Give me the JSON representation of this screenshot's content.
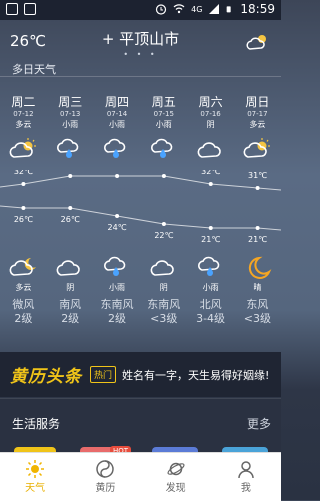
{
  "status_bar": {
    "network": "4G",
    "time": "18:59"
  },
  "header": {
    "current_temp": "26℃",
    "add_symbol": "+",
    "city": "平顶山市",
    "page_dots": "• • •"
  },
  "forecast_title": "多日天气",
  "days": [
    {
      "name": "周二",
      "date": "07-12",
      "day_cond": "多云",
      "day_icon": "partly-cloudy-sun-icon",
      "high": "32℃",
      "low": "26℃",
      "night_icon": "partly-cloudy-moon-icon",
      "night_cond": "多云",
      "wind": "微风",
      "level": "2级"
    },
    {
      "name": "周三",
      "date": "07-13",
      "day_cond": "小雨",
      "day_icon": "light-rain-icon",
      "high": "34℃",
      "low": "26℃",
      "night_icon": "cloudy-icon",
      "night_cond": "阴",
      "wind": "南风",
      "level": "2级"
    },
    {
      "name": "周四",
      "date": "07-14",
      "day_cond": "小雨",
      "day_icon": "light-rain-icon",
      "high": "34℃",
      "low": "24℃",
      "night_icon": "light-rain-icon",
      "night_cond": "小雨",
      "wind": "东南风",
      "level": "2级"
    },
    {
      "name": "周五",
      "date": "07-15",
      "day_cond": "小雨",
      "day_icon": "light-rain-icon",
      "high": "34℃",
      "low": "22℃",
      "night_icon": "cloudy-icon",
      "night_cond": "阴",
      "wind": "东南风",
      "level": "<3级"
    },
    {
      "name": "周六",
      "date": "07-16",
      "day_cond": "阴",
      "day_icon": "cloudy-icon",
      "high": "32℃",
      "low": "21℃",
      "night_icon": "light-rain-icon",
      "night_cond": "小雨",
      "wind": "北风",
      "level": "3-4级"
    },
    {
      "name": "周日",
      "date": "07-17",
      "day_cond": "多云",
      "day_icon": "partly-cloudy-sun-icon",
      "high": "31℃",
      "low": "21℃",
      "night_icon": "crescent-moon-icon",
      "night_cond": "晴",
      "wind": "东风",
      "level": "<3级"
    }
  ],
  "ad": {
    "logo": "黄历头条",
    "tag": "热门",
    "text": "姓名有一字，天生易得好姻缘!"
  },
  "life": {
    "title": "生活服务",
    "more": "更多",
    "hot_badge": "HOT"
  },
  "tabs": [
    {
      "label": "天气",
      "icon": "sun-icon",
      "active": true
    },
    {
      "label": "黄历",
      "icon": "yin-yang-icon",
      "active": false
    },
    {
      "label": "发现",
      "icon": "planet-icon",
      "active": false
    },
    {
      "label": "我",
      "icon": "person-icon",
      "active": false
    }
  ],
  "chart_data": {
    "type": "line",
    "categories": [
      "周二",
      "周三",
      "周四",
      "周五",
      "周六",
      "周日"
    ],
    "series": [
      {
        "values": [
          32,
          34,
          34,
          34,
          32,
          31
        ]
      },
      {
        "values": [
          26,
          26,
          24,
          22,
          21,
          21
        ]
      }
    ]
  }
}
